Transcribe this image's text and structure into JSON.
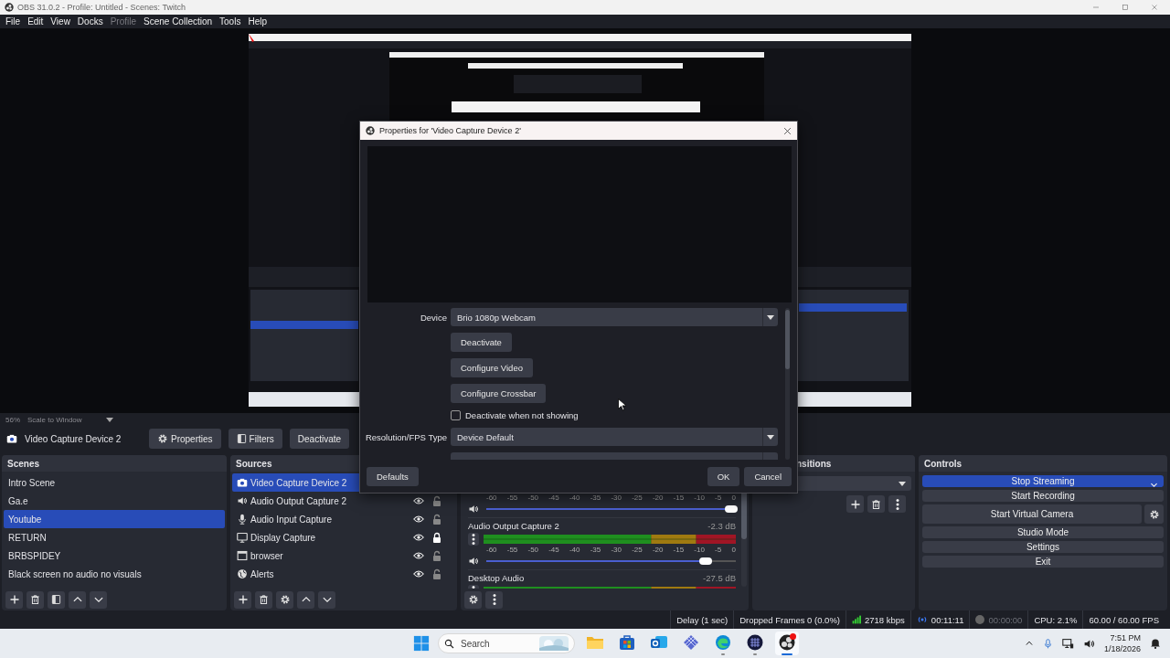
{
  "window": {
    "title": "OBS 31.0.2 - Profile: Untitled - Scenes: Twitch"
  },
  "menu": [
    {
      "label": "File",
      "disabled": false
    },
    {
      "label": "Edit",
      "disabled": false
    },
    {
      "label": "View",
      "disabled": false
    },
    {
      "label": "Docks",
      "disabled": false
    },
    {
      "label": "Profile",
      "disabled": true
    },
    {
      "label": "Scene Collection",
      "disabled": false
    },
    {
      "label": "Tools",
      "disabled": false
    },
    {
      "label": "Help",
      "disabled": false
    }
  ],
  "scale": {
    "zoom": "56%",
    "mode": "Scale to Window"
  },
  "source_toolbar": {
    "source": "Video Capture Device 2",
    "buttons": [
      {
        "label": "Properties"
      },
      {
        "label": "Filters"
      },
      {
        "label": "Deactivate"
      }
    ]
  },
  "scenes": {
    "title": "Scenes",
    "items": [
      {
        "label": "Intro Scene",
        "selected": false
      },
      {
        "label": "Ga.e",
        "selected": false
      },
      {
        "label": "Youtube",
        "selected": true
      },
      {
        "label": "RETURN",
        "selected": false
      },
      {
        "label": "BRBSPIDEY",
        "selected": false
      },
      {
        "label": "Black screen no audio no visuals",
        "selected": false
      }
    ]
  },
  "sources": {
    "title": "Sources",
    "items": [
      {
        "label": "Video Capture Device 2",
        "kind": "camera",
        "selected": true
      },
      {
        "label": "Audio Output Capture 2",
        "kind": "speaker",
        "selected": false,
        "visible": true,
        "locked": false
      },
      {
        "label": "Audio Input Capture",
        "kind": "mic",
        "selected": false,
        "visible": true,
        "locked": false
      },
      {
        "label": "Display Capture",
        "kind": "monitor",
        "selected": false,
        "visible": true,
        "locked": true
      },
      {
        "label": "browser",
        "kind": "browser",
        "selected": false,
        "visible": true,
        "locked": false
      },
      {
        "label": "Alerts",
        "kind": "globe",
        "selected": false,
        "visible": true,
        "locked": false
      }
    ]
  },
  "mixer": {
    "channels": [
      {
        "ticks": [
          "-60",
          "-55",
          "-50",
          "-45",
          "-40",
          "-35",
          "-30",
          "-25",
          "-20",
          "-15",
          "-10",
          "-5",
          "0"
        ],
        "level": 0.98
      },
      {
        "name": "Audio Output Capture 2",
        "reading": "-2.3 dB",
        "ticks": [
          "-60",
          "-55",
          "-50",
          "-45",
          "-40",
          "-35",
          "-30",
          "-25",
          "-20",
          "-15",
          "-10",
          "-5",
          "0"
        ],
        "level": 0.88
      },
      {
        "name": "Desktop Audio",
        "reading": "-27.5 dB"
      }
    ]
  },
  "transitions": {
    "title": "nsitions"
  },
  "controls": {
    "title": "Controls",
    "buttons": [
      {
        "label": "Stop Streaming",
        "kind": "menu",
        "active": true
      },
      {
        "label": "Start Recording",
        "kind": "plain",
        "active": false
      },
      {
        "label": "Start Virtual Camera",
        "kind": "settings",
        "active": false
      },
      {
        "label": "Studio Mode",
        "kind": "plain",
        "active": false
      },
      {
        "label": "Settings",
        "kind": "plain",
        "active": false
      },
      {
        "label": "Exit",
        "kind": "plain",
        "active": false
      }
    ]
  },
  "status_bar": {
    "delay": "Delay (1 sec)",
    "dropped": "Dropped Frames 0 (0.0%)",
    "bitrate": "2718 kbps",
    "streaming": true,
    "stream_time": "00:11:11",
    "recording": false,
    "record_time": "00:00:00",
    "cpu": "CPU: 2.1%",
    "fps": "60.00 / 60.00 FPS"
  },
  "dialog": {
    "title": "Properties for 'Video Capture Device 2'",
    "fields": [
      {
        "kind": "select",
        "label": "Device",
        "value": "Brio 1080p Webcam"
      },
      {
        "kind": "button",
        "label": "Deactivate"
      },
      {
        "kind": "button",
        "label": "Configure Video"
      },
      {
        "kind": "button",
        "label": "Configure Crossbar"
      },
      {
        "kind": "checkbox",
        "label": "Deactivate when not showing",
        "checked": false
      },
      {
        "kind": "select",
        "label": "Resolution/FPS Type",
        "value": "Device Default"
      },
      {
        "kind": "select"
      }
    ],
    "buttons": [
      "Defaults",
      "OK",
      "Cancel"
    ]
  },
  "taskbar": {
    "search": {
      "placeholder": "Search"
    },
    "apps": [
      {
        "kind": "folder",
        "running": false,
        "selected": false
      },
      {
        "kind": "store",
        "running": false,
        "selected": false
      },
      {
        "kind": "mail",
        "running": false,
        "selected": false
      },
      {
        "kind": "grid",
        "running": false,
        "selected": false
      },
      {
        "kind": "edge",
        "running": true,
        "selected": false
      },
      {
        "kind": "disc",
        "running": true,
        "selected": false
      },
      {
        "kind": "obs",
        "running": true,
        "selected": true
      }
    ],
    "time": "7:51 PM",
    "date": "1/18/2026"
  }
}
